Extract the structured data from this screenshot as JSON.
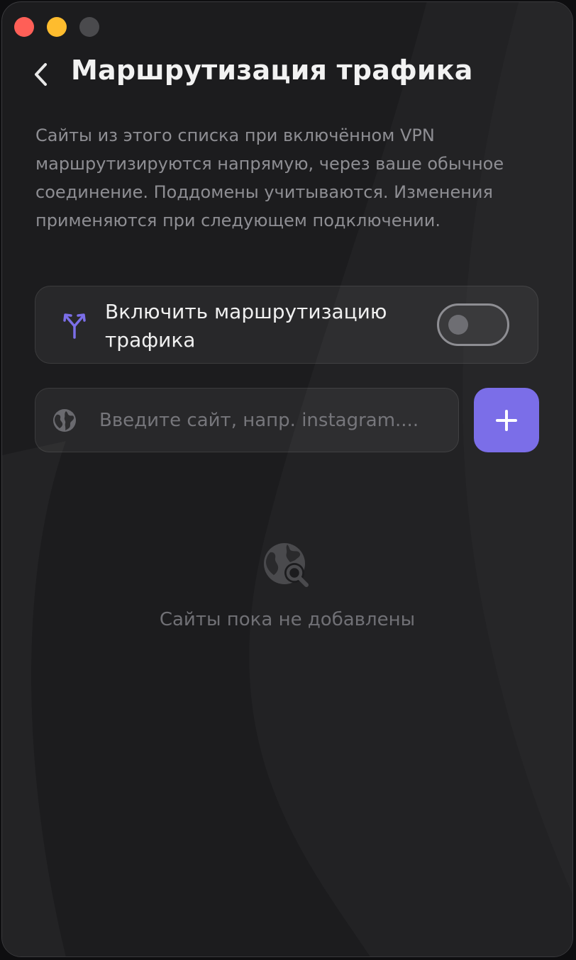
{
  "window": {
    "controls": [
      {
        "name": "close",
        "color": "#ff5f57"
      },
      {
        "name": "minimize",
        "color": "#febc2e"
      },
      {
        "name": "zoom",
        "color": "#4a4a4d"
      }
    ]
  },
  "header": {
    "back_icon": "chevron-left-icon",
    "title": "Маршрутизация трафика"
  },
  "description": "Сайты из этого списка при включённом VPN маршрутизируются напрямую, через ваше обычное соединение. Поддомены учитываются. Изменения применяются при следующем подключении.",
  "routing_toggle": {
    "icon": "split-arrows-icon",
    "label": "Включить маршрутизацию трафика",
    "enabled": false
  },
  "site_input": {
    "icon": "globe-icon",
    "value": "",
    "placeholder": "Введите сайт, напр. instagram...."
  },
  "add_button": {
    "icon": "plus-icon",
    "color": "#7b6ee8"
  },
  "empty_state": {
    "icon": "globe-search-icon",
    "text": "Сайты пока не добавлены"
  }
}
